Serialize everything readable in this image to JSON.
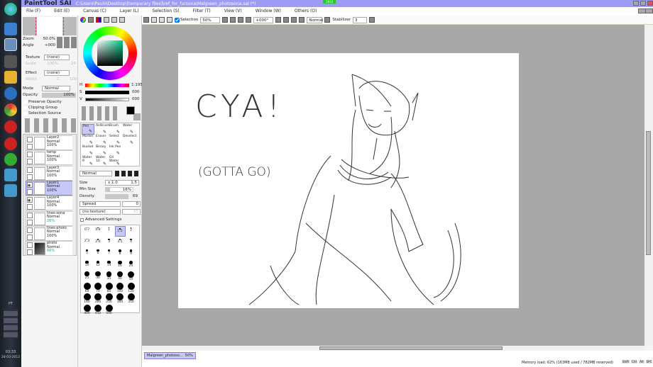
{
  "window": {
    "app_logo": "PaintTool SAI",
    "title": "C:\\Users\\Paulo\\Desktop\\[temporary files]\\ref_for_fursona\\Malgreen_photosona.sai (*)",
    "battery_badge": "1910"
  },
  "menu": [
    "File (F)",
    "Edit (E)",
    "Canvas (C)",
    "Layer (L)",
    "Selection (S)",
    "Filter (T)",
    "View (V)",
    "Window (W)",
    "Others (O)"
  ],
  "toolbar": {
    "selection_label": "Selection",
    "selection_checked": true,
    "zoom": "50%",
    "angle": "+000°",
    "blend": "Normal",
    "stabilizer_label": "Stabilizer",
    "stabilizer": "3"
  },
  "navigator": {
    "zoom_label": "Zoom",
    "zoom": "50.0%",
    "angle_label": "Angle",
    "angle": "+000"
  },
  "layer_props": {
    "texture_label": "Texture",
    "texture": "(none)",
    "scale_label": "Scale",
    "scale": "100%",
    "scale_val": "20",
    "effect_label": "Effect",
    "effect": "(none)",
    "width_label": "Width",
    "width": "1",
    "width_val": "100",
    "mode_label": "Mode",
    "mode": "Normal",
    "opacity_label": "Opacity",
    "opacity": "100%",
    "checks": [
      "Preserve Opacity",
      "Clipping Group",
      "Selection Source"
    ]
  },
  "layers": [
    {
      "name": "Layer2",
      "mode": "Normal",
      "opacity": "100%",
      "visible": false,
      "active": false
    },
    {
      "name": "temp",
      "mode": "Normal",
      "opacity": "100%",
      "visible": false,
      "active": false
    },
    {
      "name": "Layer3",
      "mode": "Normal",
      "opacity": "100%",
      "visible": false,
      "active": false
    },
    {
      "name": "Layer1",
      "mode": "Normal",
      "opacity": "100%",
      "visible": true,
      "active": true
    },
    {
      "name": "Layer4",
      "mode": "Normal",
      "opacity": "100%",
      "visible": true,
      "active": false
    },
    {
      "name": "lines-sona",
      "mode": "Normal",
      "opacity": "26%",
      "visible": false,
      "active": false
    },
    {
      "name": "lines-photo",
      "mode": "Normal",
      "opacity": "100%",
      "visible": false,
      "active": false
    },
    {
      "name": "photo",
      "mode": "Normal",
      "opacity": "66%",
      "visible": false,
      "active": false
    }
  ],
  "color": {
    "h_label": "H",
    "h": "1:195",
    "s_label": "S",
    "s": "000",
    "v_label": "V",
    "v": "000",
    "foreground": "#000000"
  },
  "tools": [
    {
      "name": "Pen"
    },
    {
      "name": "AirBrush"
    },
    {
      "name": "Brush"
    },
    {
      "name": "Water"
    },
    {
      "name": "Marker"
    },
    {
      "name": "Eraser"
    },
    {
      "name": "Select"
    },
    {
      "name": "Deselect"
    },
    {
      "name": "Bucket"
    },
    {
      "name": "Binary"
    },
    {
      "name": "Ink Pen"
    },
    {
      "name": ""
    },
    {
      "name": "Water 9"
    },
    {
      "name": "Water 10"
    },
    {
      "name": "Oil Water"
    },
    {
      "name": ""
    }
  ],
  "brush": {
    "mode": "Normal",
    "size_label": "Size",
    "size_mult": "x 1.0",
    "size": "1.5",
    "minsize_label": "Min Size",
    "minsize": "16%",
    "density_label": "Density",
    "density": "69",
    "spread": "Spread",
    "spread_val": "0",
    "texture": "(no texture)",
    "texture_val": "95",
    "advanced": "Advanced Settings"
  },
  "sizes": [
    "0.7",
    "0.8",
    "1",
    "1.5",
    "2",
    "2.3",
    "2.6",
    "3",
    "3.5",
    "4",
    "5",
    "6",
    "7",
    "8",
    "9",
    "10",
    "12",
    "14",
    "16",
    "20",
    "25",
    "30",
    "35",
    "40",
    "50",
    "60",
    "70",
    "80",
    "100",
    "120",
    "160",
    "200",
    "250",
    "300",
    "350",
    "400",
    "450",
    "500"
  ],
  "active_size": "1.5",
  "drawing": {
    "text1": "CYA!",
    "text2": "(GOTTA GO)"
  },
  "document_tab": {
    "name": "Malgreen_photoso...",
    "zoom": "50%"
  },
  "status": {
    "memory": "Memory load: 62% (163MB used / 782MB reserved)",
    "keys": [
      "Shift",
      "Ctrl",
      "Alt",
      "SPC"
    ]
  },
  "clock": {
    "lang": "PT",
    "time": "03:33",
    "date": "28-03-2012"
  }
}
